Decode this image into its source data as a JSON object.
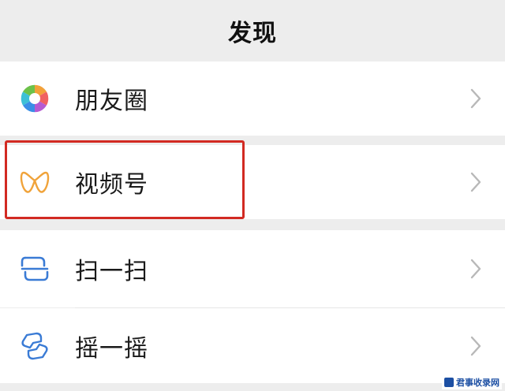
{
  "header": {
    "title": "发现"
  },
  "items": [
    {
      "label": "朋友圈",
      "icon": "moments-aperture-icon"
    },
    {
      "label": "视频号",
      "icon": "channels-butterfly-icon",
      "highlighted": true
    },
    {
      "label": "扫一扫",
      "icon": "scan-icon"
    },
    {
      "label": "摇一摇",
      "icon": "shake-icon"
    }
  ],
  "highlight_color": "#d22a22",
  "watermark": {
    "text": "君事收录网"
  }
}
